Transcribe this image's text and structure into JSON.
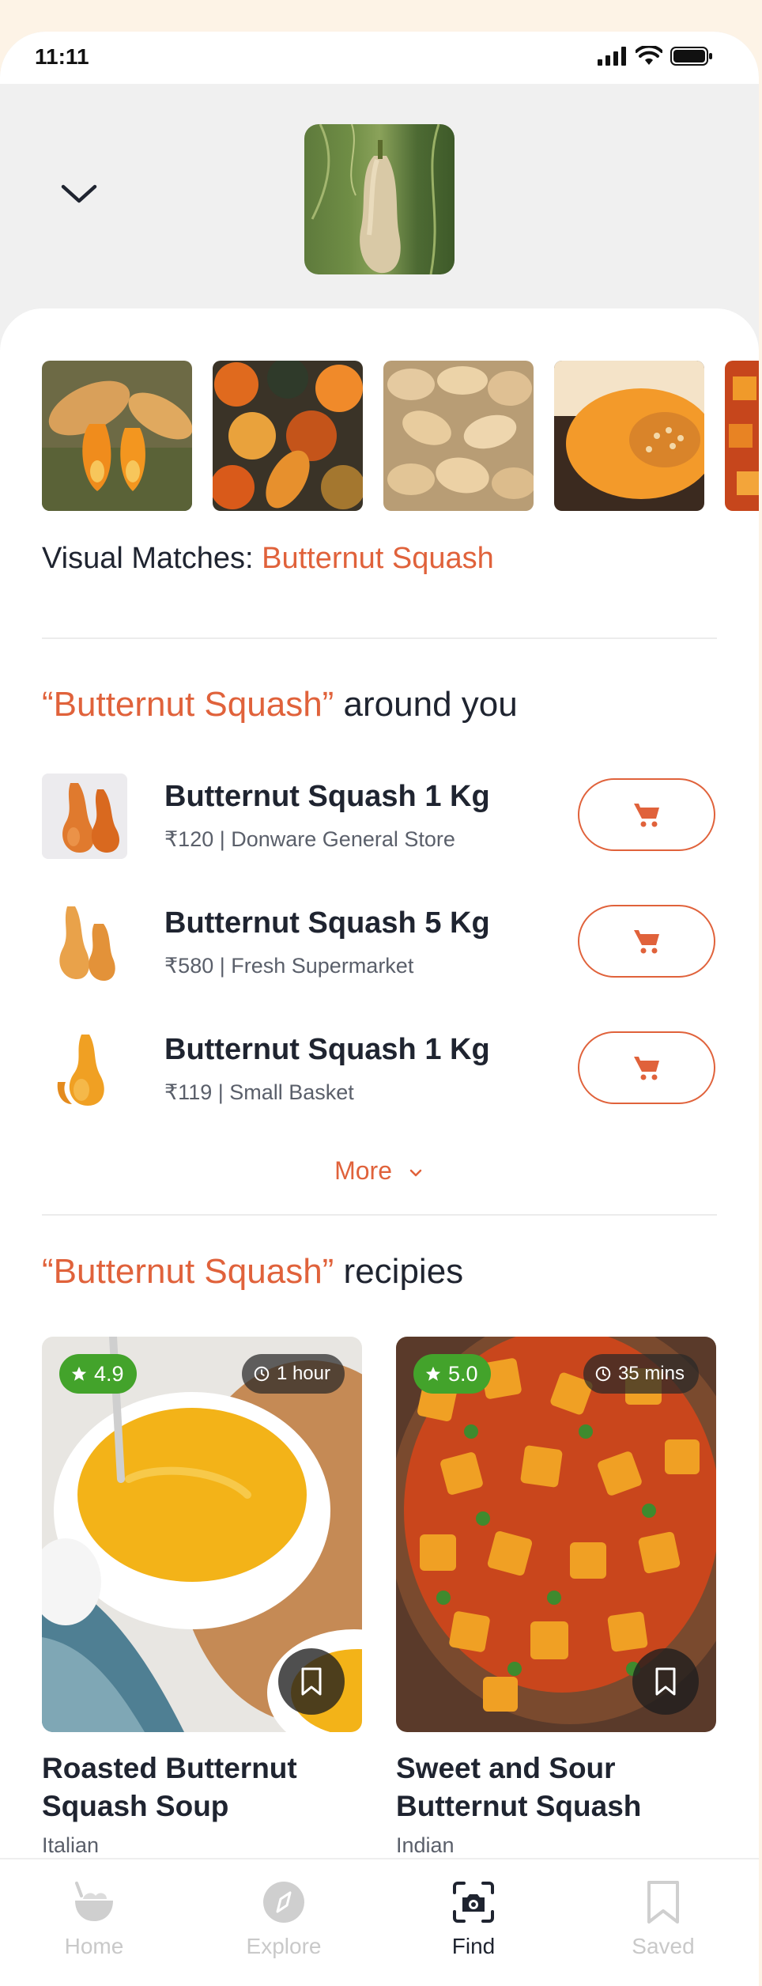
{
  "status": {
    "time": "11:11"
  },
  "header": {
    "hero_image": "butternut-squash-on-vine"
  },
  "gallery": {
    "images": [
      "squash-halves-on-grass",
      "assorted-pumpkins",
      "butternut-pile",
      "squash-cut-open",
      "squash-dish"
    ]
  },
  "visual_matches": {
    "label": "Visual Matches:",
    "value": "Butternut Squash"
  },
  "nearby": {
    "title_highlight": "“Butternut Squash”",
    "title_rest": " around you",
    "products": [
      {
        "name": "Butternut Squash 1 Kg",
        "meta": "₹120 | Donware General Store"
      },
      {
        "name": "Butternut Squash 5 Kg",
        "meta": "₹580 | Fresh Supermarket"
      },
      {
        "name": "Butternut Squash 1 Kg",
        "meta": "₹119 | Small Basket"
      }
    ],
    "more_label": "More"
  },
  "recipes": {
    "title_highlight": "“Butternut Squash”",
    "title_rest": " recipies",
    "items": [
      {
        "rating": "4.9",
        "time": "1 hour",
        "title": "Roasted Butternut Squash Soup",
        "cuisine": "Italian"
      },
      {
        "rating": "5.0",
        "time": "35 mins",
        "title": "Sweet and Sour Butternut Squash",
        "cuisine": "Indian"
      }
    ]
  },
  "nav": {
    "items": [
      {
        "label": "Home",
        "icon": "bowl-icon"
      },
      {
        "label": "Explore",
        "icon": "compass-icon"
      },
      {
        "label": "Find",
        "icon": "camera-scan-icon"
      },
      {
        "label": "Saved",
        "icon": "bookmark-icon"
      }
    ],
    "active": "Find"
  },
  "colors": {
    "accent": "#e0623b",
    "rating_green": "#43a32b"
  }
}
